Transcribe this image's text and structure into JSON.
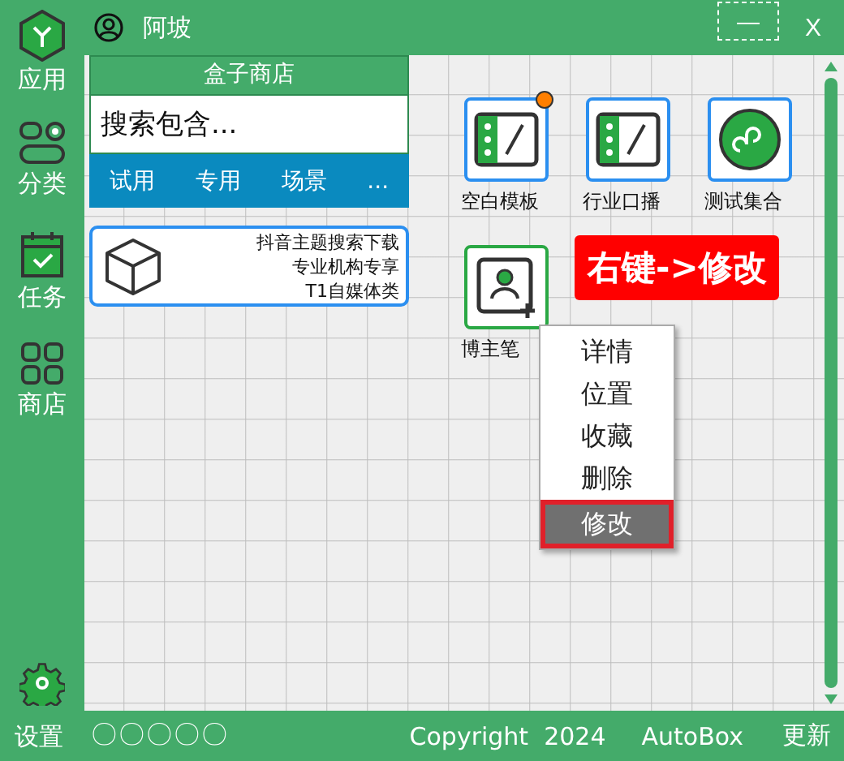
{
  "top_bar": {
    "user": "阿坡",
    "minimize": "—",
    "close": "X"
  },
  "sidebar": {
    "items": [
      {
        "label": "应用",
        "kind": "app"
      },
      {
        "label": "分类",
        "kind": "category"
      },
      {
        "label": "任务",
        "kind": "task"
      },
      {
        "label": "商店",
        "kind": "store"
      }
    ],
    "settings": "设置"
  },
  "store": {
    "title": "盒子商店",
    "search": {
      "placeholder": "搜索包含..."
    },
    "tabs": [
      "试用",
      "专用",
      "场景",
      "..."
    ],
    "card": {
      "lines": [
        "抖音主题搜索下载",
        "专业机构专享",
        "T1自媒体类"
      ]
    }
  },
  "apps": [
    {
      "label": "空白模板",
      "kind": "panel",
      "badge": true,
      "selected": false
    },
    {
      "label": "行业口播",
      "kind": "panel",
      "badge": false,
      "selected": false
    },
    {
      "label": "测试集合",
      "kind": "link",
      "badge": false,
      "selected": false
    },
    {
      "label": "博主笔",
      "kind": "person",
      "badge": false,
      "selected": true
    }
  ],
  "banner": "右键->修改",
  "context_menu": [
    {
      "label": "详情",
      "selected": false
    },
    {
      "label": "位置",
      "selected": false
    },
    {
      "label": "收藏",
      "selected": false
    },
    {
      "label": "删除",
      "selected": false
    },
    {
      "label": "修改",
      "selected": true
    }
  ],
  "status_bar": {
    "indicators": "〇〇〇〇〇",
    "copyright": "Copyright  2024",
    "product": "AutoBox",
    "update": "更新"
  }
}
